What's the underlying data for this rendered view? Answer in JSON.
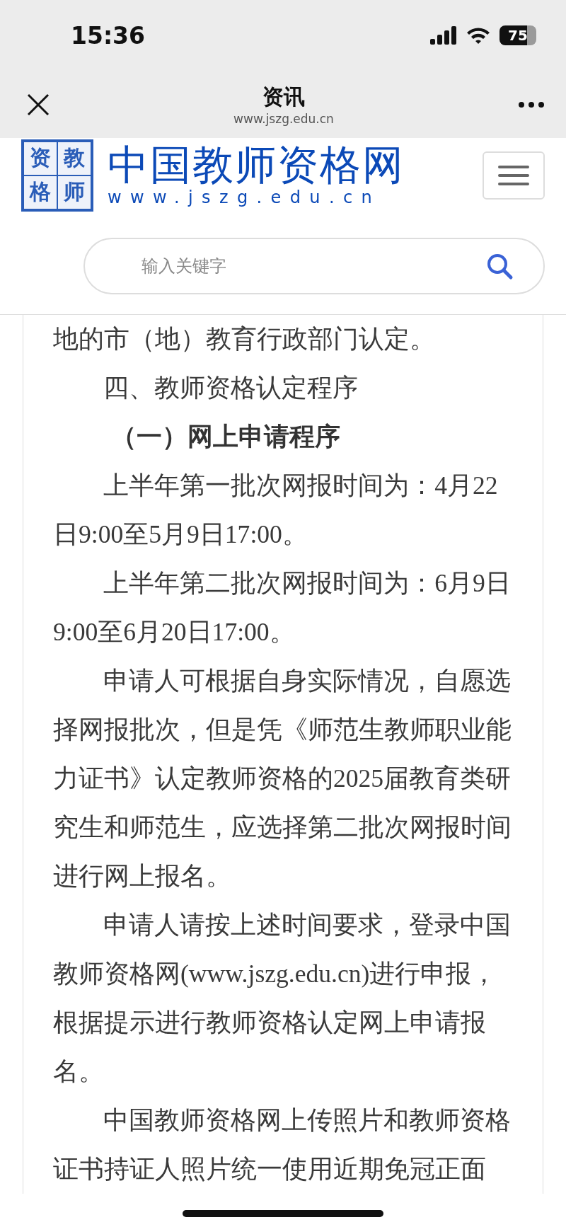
{
  "status_bar": {
    "time": "15:36",
    "battery": "75"
  },
  "nav_bar": {
    "title": "资讯",
    "subtitle": "www.jszg.edu.cn"
  },
  "site_header": {
    "logo_chars": [
      "资",
      "教",
      "格",
      "师"
    ],
    "site_name": "中国教师资格网",
    "site_url": "www.jszg.edu.cn"
  },
  "search": {
    "placeholder": "输入关键字"
  },
  "article": [
    {
      "kind": "text",
      "indent": false,
      "text": "地的市（地）教育行政部门认定。"
    },
    {
      "kind": "text",
      "indent": true,
      "text": "四、教师资格认定程序"
    },
    {
      "kind": "heading",
      "indent": true,
      "text": "（一）网上申请程序"
    },
    {
      "kind": "text",
      "indent": true,
      "text": "上半年第一批次网报时间为：4月22日9:00至5月9日17:00。"
    },
    {
      "kind": "text",
      "indent": true,
      "text": "上半年第二批次网报时间为：6月9日9:00至6月20日17:00。"
    },
    {
      "kind": "text",
      "indent": true,
      "text": "申请人可根据自身实际情况，自愿选择网报批次，但是凭《师范生教师职业能力证书》认定教师资格的2025届教育类研究生和师范生，应选择第二批次网报时间进行网上报名。"
    },
    {
      "kind": "text",
      "indent": true,
      "text": "申请人请按上述时间要求，登录中国教师资格网(www.jszg.edu.cn)进行申报，根据提示进行教师资格认定网上申请报名。"
    },
    {
      "kind": "text",
      "indent": true,
      "text": "中国教师资格网上传照片和教师资格证书持证人照片统一使用近期免冠正面"
    }
  ]
}
